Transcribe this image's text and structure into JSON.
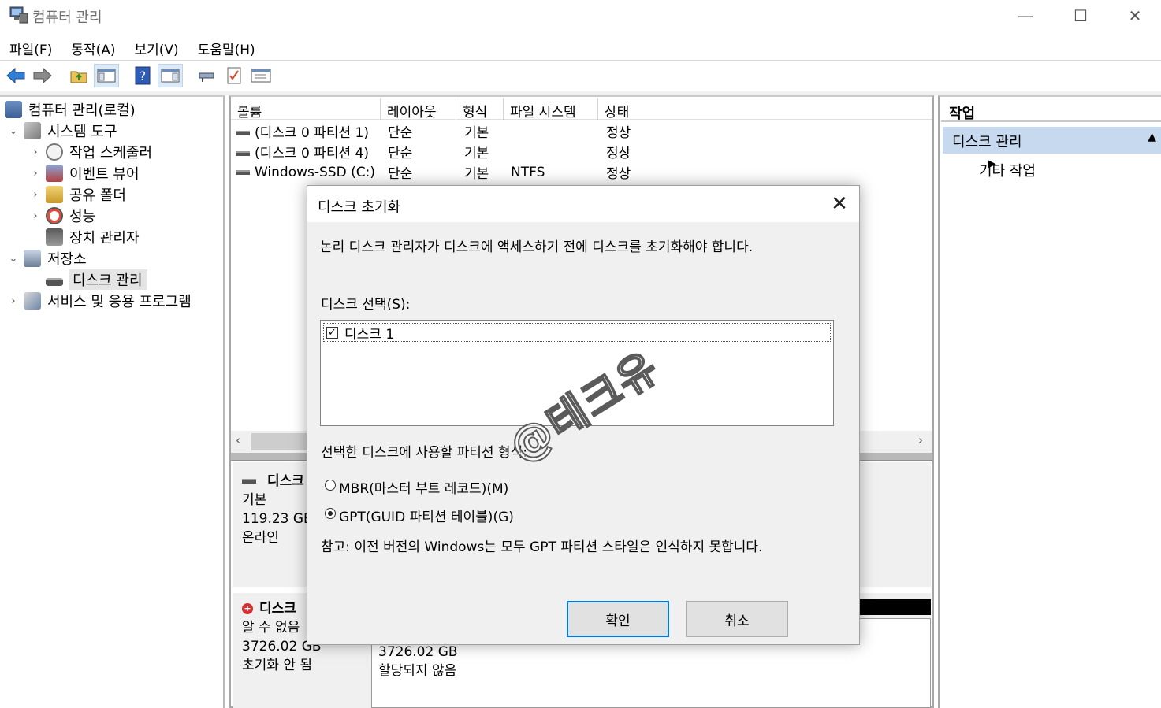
{
  "window": {
    "title": "컴퓨터 관리",
    "controls": {
      "minimize": "—",
      "maximize": "☐",
      "close": "✕"
    }
  },
  "menu": [
    "파일(F)",
    "동작(A)",
    "보기(V)",
    "도움말(H)"
  ],
  "toolbar": {
    "icons": [
      "back-arrow-icon",
      "forward-arrow-icon",
      "up-folder-icon",
      "show-hide-tree-icon",
      "help-icon",
      "show-hide-action-icon",
      "connect-icon",
      "checklist-icon",
      "properties-icon"
    ]
  },
  "tree": [
    {
      "label": "컴퓨터 관리(로컬)",
      "icon": "computer-management-icon",
      "level": 0,
      "expander": ""
    },
    {
      "label": "시스템 도구",
      "icon": "system-tools-icon",
      "level": 1,
      "expander": "⌄"
    },
    {
      "label": "작업 스케줄러",
      "icon": "task-scheduler-icon",
      "level": 2,
      "expander": "›"
    },
    {
      "label": "이벤트 뷰어",
      "icon": "event-viewer-icon",
      "level": 2,
      "expander": "›"
    },
    {
      "label": "공유 폴더",
      "icon": "shared-folders-icon",
      "level": 2,
      "expander": "›"
    },
    {
      "label": "성능",
      "icon": "performance-icon",
      "level": 2,
      "expander": "›"
    },
    {
      "label": "장치 관리자",
      "icon": "device-manager-icon",
      "level": 2,
      "expander": ""
    },
    {
      "label": "저장소",
      "icon": "storage-icon",
      "level": 1,
      "expander": "⌄"
    },
    {
      "label": "디스크 관리",
      "icon": "disk-management-icon",
      "level": 2,
      "expander": "",
      "selected": true
    },
    {
      "label": "서비스 및 응용 프로그램",
      "icon": "services-apps-icon",
      "level": 1,
      "expander": "›"
    }
  ],
  "volume_table": {
    "headers": [
      "볼륨",
      "레이아웃",
      "형식",
      "파일 시스템",
      "상태"
    ],
    "rows": [
      [
        "(디스크 0 파티션 1)",
        "단순",
        "기본",
        "",
        "정상"
      ],
      [
        "(디스크 0 파티션 4)",
        "단순",
        "기본",
        "",
        "정상"
      ],
      [
        "Windows-SSD (C:)",
        "단순",
        "기본",
        "NTFS",
        "정상"
      ]
    ]
  },
  "disk0": {
    "name": "디스크",
    "type": "기본",
    "size": "119.23 GB",
    "status": "온라인"
  },
  "disk1": {
    "name": "디스크",
    "type": "알 수 없음",
    "size": "3726.02 GB",
    "status": "초기화 안 됨",
    "partition_size": "3726.02 GB",
    "partition_status": "할당되지 않음"
  },
  "actions": {
    "header": "작업",
    "section": "디스크 관리",
    "collapse": "▲",
    "other": "기타 작업",
    "other_arrow": "▶"
  },
  "dialog": {
    "title": "디스크 초기화",
    "close": "✕",
    "message": "논리 디스크 관리자가 디스크에 액세스하기 전에 디스크를 초기화해야 합니다.",
    "select_label": "디스크 선택(S):",
    "disk_item": "디스크 1",
    "disk_checked": "✓",
    "partition_style_label": "선택한 디스크에 사용할 파티션 형식:",
    "mbr_label": "MBR(마스터 부트 레코드)(M)",
    "gpt_label": "GPT(GUID 파티션 테이블)(G)",
    "selected_style": "GPT",
    "note": "참고: 이전 버전의 Windows는 모두 GPT 파티션 스타일은 인식하지 못합니다.",
    "ok": "확인",
    "cancel": "취소"
  },
  "watermark": "@테크유"
}
